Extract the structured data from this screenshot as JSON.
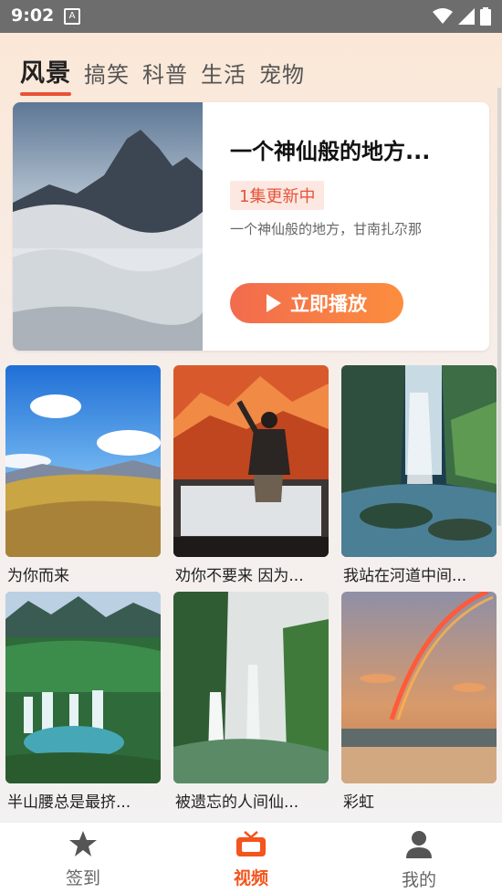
{
  "status_bar": {
    "time": "9:02",
    "notification_icon": "a-box-icon",
    "icons": [
      "wifi-icon",
      "signal-icon",
      "battery-icon"
    ]
  },
  "tabs": [
    {
      "label": "风景",
      "active": true
    },
    {
      "label": "搞笑",
      "active": false
    },
    {
      "label": "科普",
      "active": false
    },
    {
      "label": "生活",
      "active": false
    },
    {
      "label": "宠物",
      "active": false
    }
  ],
  "featured": {
    "title": "一个神仙般的地方...",
    "badge": "1集更新中",
    "description": "一个神仙般的地方，甘南扎尕那",
    "play_label": "立即播放"
  },
  "videos": [
    {
      "caption": "为你而来"
    },
    {
      "caption": "劝你不要来 因为..."
    },
    {
      "caption": "我站在河道中间..."
    },
    {
      "caption": "半山腰总是最挤..."
    },
    {
      "caption": "被遗忘的人间仙..."
    },
    {
      "caption": "彩虹"
    }
  ],
  "bottom_nav": [
    {
      "label": "签到",
      "icon": "star-icon",
      "active": false
    },
    {
      "label": "视频",
      "icon": "tv-icon",
      "active": true
    },
    {
      "label": "我的",
      "icon": "user-icon",
      "active": false
    }
  ],
  "colors": {
    "accent": "#e85236",
    "nav_active": "#f4541d",
    "badge_bg": "#fde8e1"
  }
}
